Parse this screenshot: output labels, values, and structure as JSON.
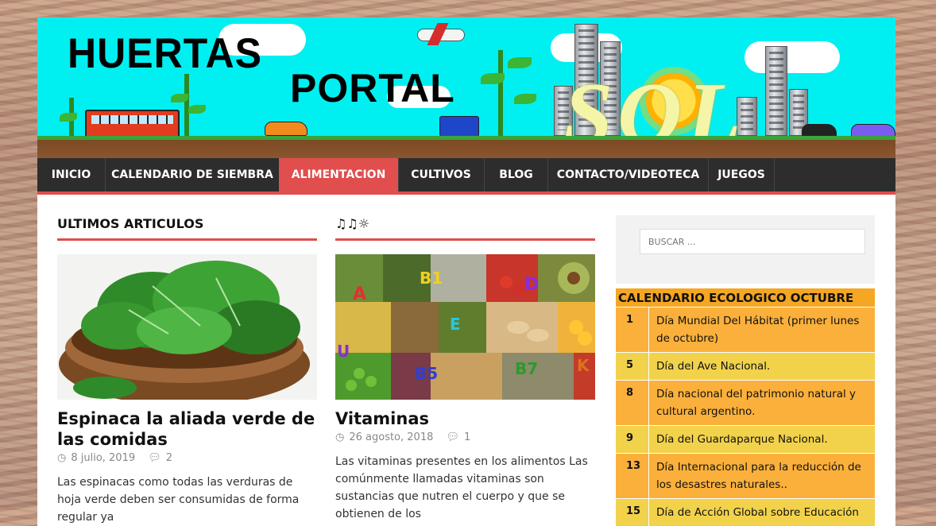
{
  "site": {
    "title_line1": "HUERTAS",
    "title_line2": "PORTAL",
    "title_art": "SOL"
  },
  "nav": {
    "items": [
      {
        "label": "INICIO"
      },
      {
        "label": "CALENDARIO DE SIEMBRA"
      },
      {
        "label": "ALIMENTACION",
        "active": true
      },
      {
        "label": "CULTIVOS"
      },
      {
        "label": "BLOG"
      },
      {
        "label": "CONTACTO/VIDEOTECA"
      },
      {
        "label": "JUEGOS"
      }
    ]
  },
  "latest": {
    "heading": "ULTIMOS ARTICULOS",
    "article": {
      "title": "Espinaca la aliada verde de las comidas",
      "date": "8 julio, 2019",
      "comments": "2",
      "excerpt": "Las espinacas como todas las verduras de hoja verde deben ser consumidas de forma regular ya"
    }
  },
  "second": {
    "heading": "♫♫☼",
    "article": {
      "title": "Vitaminas",
      "date": "26 agosto, 2018",
      "comments": "1",
      "excerpt": "Las vitaminas presentes en los alimentos   Las comúnmente llamadas vitaminas son sustancias que nutren el cuerpo y que se obtienen de los"
    },
    "image_labels": [
      "A",
      "B1",
      "D",
      "E",
      "U",
      "B5",
      "B7",
      "K"
    ]
  },
  "sidebar": {
    "search_placeholder": "BUSCAR ...",
    "calendar": {
      "title": "CALENDARIO ECOLOGICO OCTUBRE",
      "rows": [
        {
          "day": "1",
          "text": "Día Mundial Del Hábitat (primer lunes de octubre)"
        },
        {
          "day": "5",
          "text": "Día del Ave Nacional."
        },
        {
          "day": "8",
          "text": "Día nacional del patrimonio natural y cultural argentino."
        },
        {
          "day": "9",
          "text": "Día del Guardaparque Nacional."
        },
        {
          "day": "13",
          "text": "Día Internacional para la reducción de los desastres naturales.."
        },
        {
          "day": "15",
          "text": "Día de Acción Global sobre Educación"
        }
      ]
    }
  },
  "colors": {
    "accent": "#e04e4e",
    "nav_bg": "#2d2d2d",
    "banner_sky": "#00f0f2",
    "calendar_orange": "#fbb03b",
    "calendar_yellow": "#f2d24b"
  }
}
